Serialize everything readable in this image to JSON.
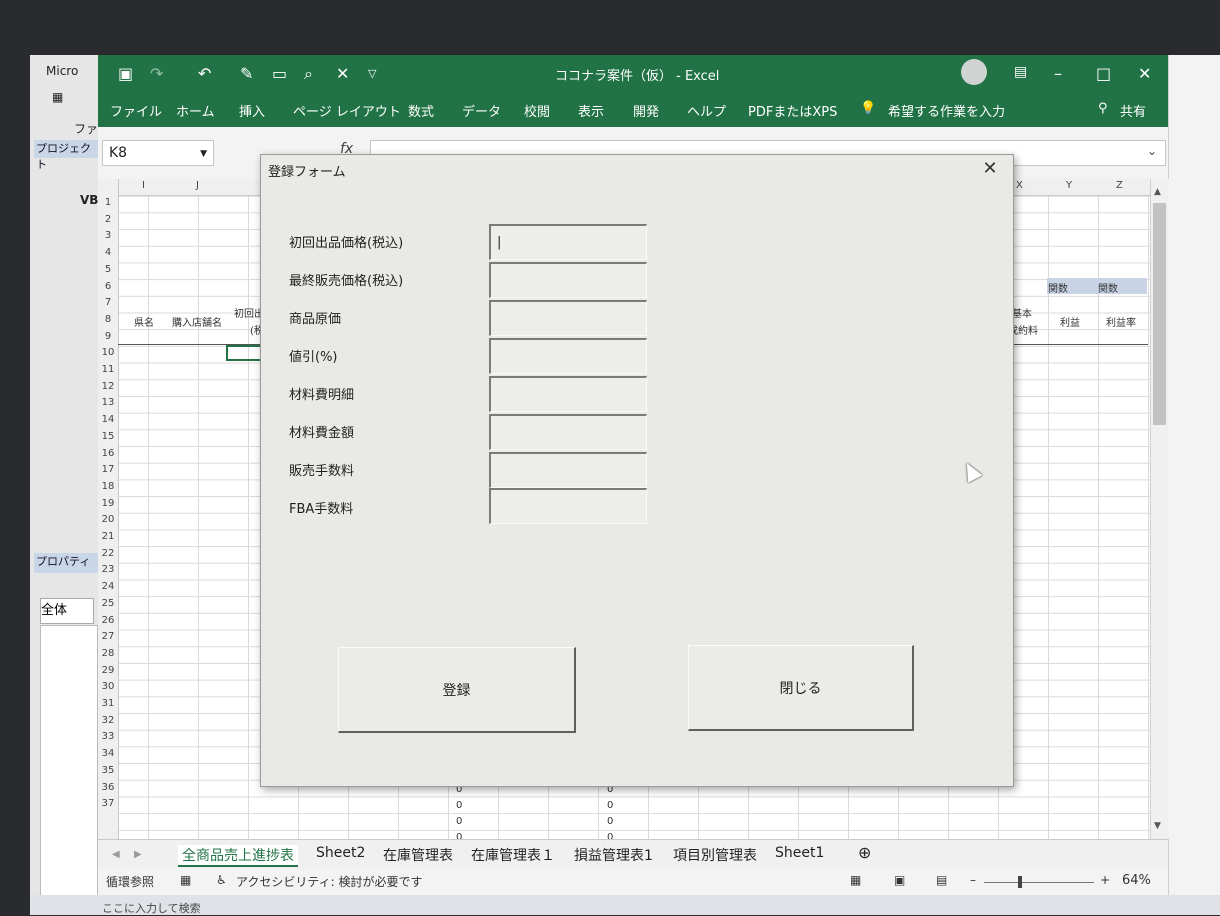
{
  "background_window": {
    "rows": [
      "Micro",
      "ファ",
      "VB",
      "プロジェクト",
      "プロパティ",
      "全体"
    ]
  },
  "excel": {
    "window_title": "ココナラ案件（仮） - Excel",
    "ribbon_tabs": [
      "ファイル",
      "ホーム",
      "挿入",
      "ページ レイアウト",
      "数式",
      "データ",
      "校閲",
      "表示",
      "開発",
      "ヘルプ",
      "PDFまたはXPS"
    ],
    "tell_me": "希望する作業を入力",
    "share": "共有",
    "name_box": "K8",
    "formula_icon": "fx",
    "col_left": [
      "I",
      "J"
    ],
    "col_right": [
      "X",
      "Y",
      "Z"
    ],
    "row_numbers": [
      "1",
      "2",
      "3",
      "4",
      "5",
      "6",
      "7",
      "8",
      "9",
      "10",
      "11",
      "12",
      "13",
      "14",
      "15",
      "16",
      "17",
      "18",
      "19",
      "20",
      "21",
      "22",
      "23",
      "24",
      "25",
      "26",
      "27",
      "28",
      "29",
      "30",
      "31",
      "32",
      "33",
      "34",
      "35",
      "36",
      "37"
    ],
    "cells": {
      "prefecture": "県名",
      "store": "購入店舗名",
      "first_price_partial": "初回出",
      "first_price_sub": "(税",
      "func1": "関数",
      "func2": "関数",
      "basic_fee_1": "基本",
      "basic_fee_2": "成約料",
      "profit": "利益",
      "profit_rate": "利益率",
      "zero": "0"
    },
    "sheet_tabs": [
      "全商品売上進捗表",
      "Sheet2",
      "在庫管理表",
      "在庫管理表１",
      "損益管理表1",
      "項目別管理表",
      "Sheet1"
    ],
    "status": {
      "circular_ref": "循環参照",
      "accessibility": "アクセシビリティ: 検討が必要です",
      "zoom": "64%"
    }
  },
  "dialog": {
    "title": "登録フォーム",
    "close_glyph": "✕",
    "fields": [
      {
        "label": "初回出品価格(税込)",
        "value": "|"
      },
      {
        "label": "最終販売価格(税込)",
        "value": ""
      },
      {
        "label": "商品原価",
        "value": ""
      },
      {
        "label": "値引(%)",
        "value": ""
      },
      {
        "label": "材料費明細",
        "value": ""
      },
      {
        "label": "材料費金額",
        "value": ""
      },
      {
        "label": "販売手数料",
        "value": ""
      },
      {
        "label": "FBA手数料",
        "value": ""
      }
    ],
    "register_button": "登録",
    "close_button": "閉じる"
  },
  "taskbar": {
    "search_placeholder": "ここに入力して検索"
  }
}
